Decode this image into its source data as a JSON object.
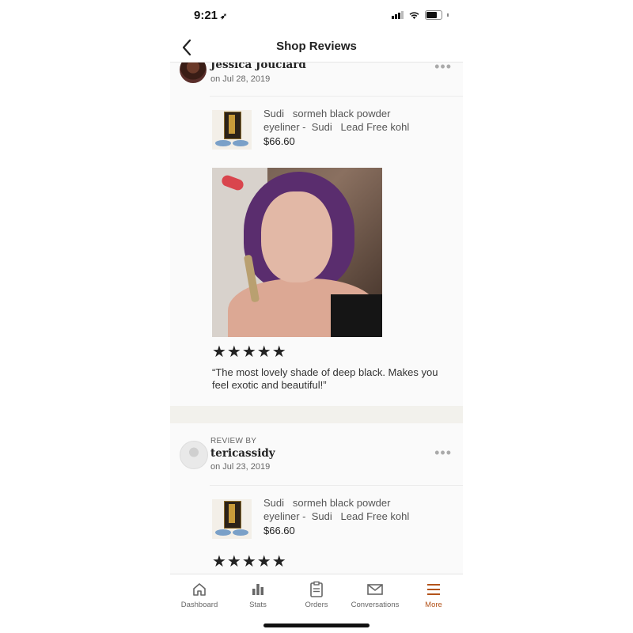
{
  "status_bar": {
    "time": "9:21",
    "location_arrow": "➶"
  },
  "nav": {
    "back_icon": "chevron-left-icon",
    "back_glyph": "‹",
    "title": "Shop Reviews"
  },
  "reviews": [
    {
      "reviewer": "Jessica Jouclard",
      "date": "on Jul 28, 2019",
      "product_title": "Sudi   sormeh black powder\neyeliner -  Sudi   Lead Free kohl",
      "price": "$66.60",
      "stars": "★★★★★",
      "rating": 5,
      "text": "“The most lovely shade of deep black.   Makes you feel exotic and beautiful!”"
    },
    {
      "review_by": "REVIEW BY",
      "reviewer": "tericassidy",
      "date": "on Jul 23, 2019",
      "product_title": "Sudi   sormeh black powder\neyeliner -  Sudi   Lead Free kohl",
      "price": "$66.60",
      "stars": "★★★★★",
      "rating": 5
    }
  ],
  "more_glyph": "•••",
  "tabs": [
    {
      "label": "Dashboard",
      "icon": "home-icon"
    },
    {
      "label": "Stats",
      "icon": "bar-chart-icon"
    },
    {
      "label": "Orders",
      "icon": "clipboard-icon"
    },
    {
      "label": "Conversations",
      "icon": "envelope-icon"
    },
    {
      "label": "More",
      "icon": "menu-icon",
      "active": true
    }
  ],
  "colors": {
    "accent": "#b3531a",
    "text": "#222222",
    "muted": "#666666"
  }
}
